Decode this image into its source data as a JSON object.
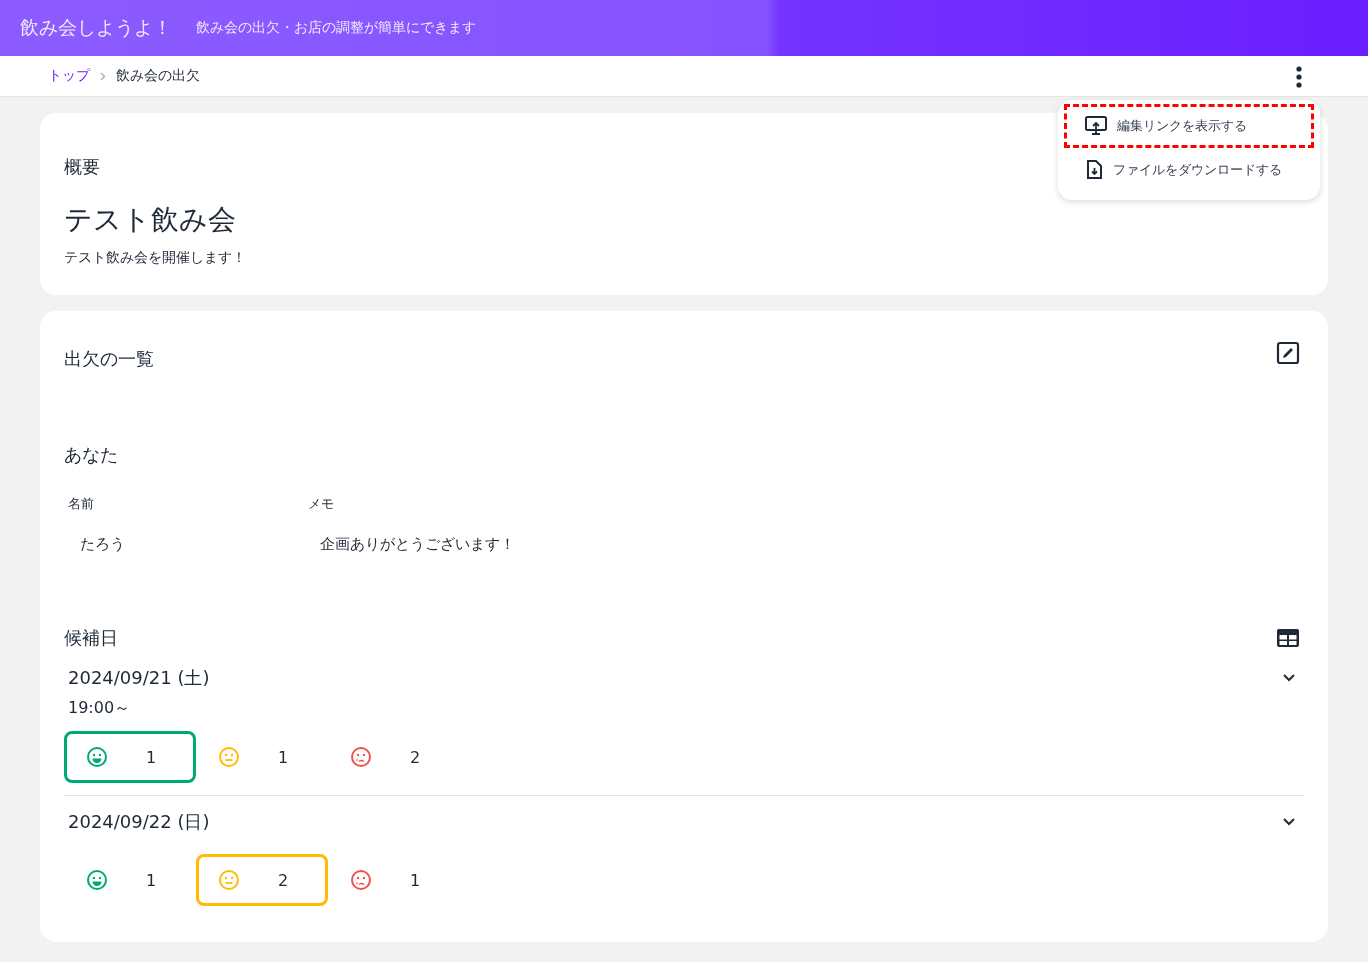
{
  "header": {
    "title": "飲み会しようよ！",
    "subtitle": "飲み会の出欠・お店の調整が簡単にできます"
  },
  "breadcrumb": [
    {
      "label": "トップ",
      "kind": "link"
    },
    {
      "label": "飲み会の出欠",
      "kind": "current"
    }
  ],
  "menu": {
    "items": [
      {
        "label": "編集リンクを表示する",
        "kind": "link",
        "highlighted": true
      },
      {
        "label": "ファイルをダウンロードする",
        "kind": "download",
        "highlighted": false
      }
    ]
  },
  "overview": {
    "heading": "概要",
    "title": "テスト飲み会",
    "description": "テスト飲み会を開催します！"
  },
  "attendance": {
    "heading": "出欠の一覧",
    "you": {
      "heading": "あなた",
      "columns": [
        "名前",
        "メモ"
      ],
      "values": [
        "たろう",
        "企画ありがとうございます！"
      ]
    },
    "candidates_heading": "候補日",
    "candidates": [
      {
        "date": "2024/09/21 (土)",
        "time": "19:00～",
        "expanded": false,
        "responses": [
          {
            "kind": "ok",
            "count": "1",
            "selected": true
          },
          {
            "kind": "maybe",
            "count": "1",
            "selected": false
          },
          {
            "kind": "no",
            "count": "2",
            "selected": false
          }
        ]
      },
      {
        "date": "2024/09/22 (日)",
        "expanded": false,
        "responses": [
          {
            "kind": "ok",
            "count": "1",
            "selected": false
          },
          {
            "kind": "maybe",
            "count": "2",
            "selected": true
          },
          {
            "kind": "no",
            "count": "1",
            "selected": false
          }
        ]
      }
    ]
  }
}
